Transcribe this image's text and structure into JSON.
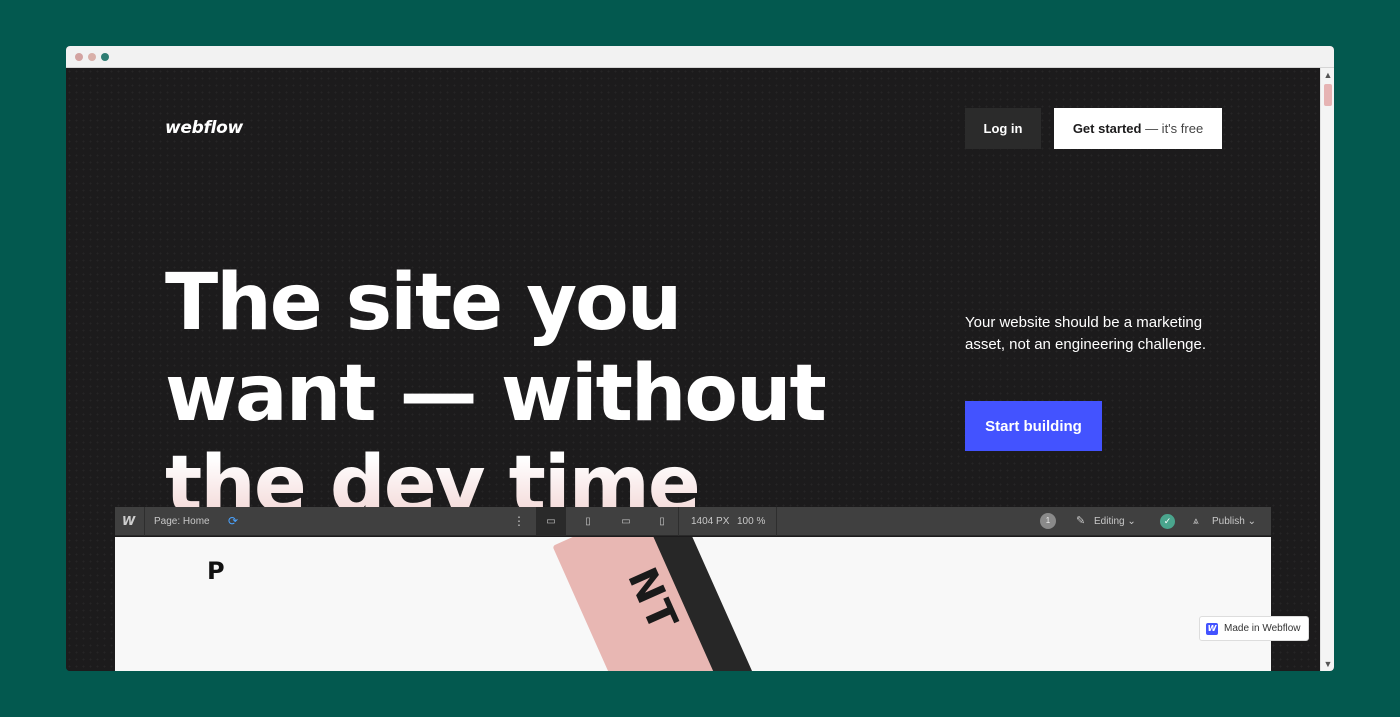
{
  "header": {
    "logo": "webflow",
    "login_label": "Log in",
    "get_started_bold": "Get started",
    "get_started_light": " — it's free"
  },
  "hero": {
    "headline": [
      "The site you",
      "want — without",
      "the dev time"
    ],
    "tagline": "Your website should be a marketing asset, not an engineering challenge.",
    "cta_label": "Start building"
  },
  "designer": {
    "logo": "W",
    "page_label": "Page: Home",
    "canvas_width": "1404 PX",
    "zoom": "100 %",
    "collaborator_count": "1",
    "mode_label": "Editing",
    "publish_label": "Publish",
    "canvas_logo": "P",
    "card_text": "NT"
  },
  "badge": {
    "icon": "W",
    "label": "Made in Webflow"
  },
  "colors": {
    "background": "#03594f",
    "page": "#1c1b1c",
    "accent": "#4353ff"
  }
}
